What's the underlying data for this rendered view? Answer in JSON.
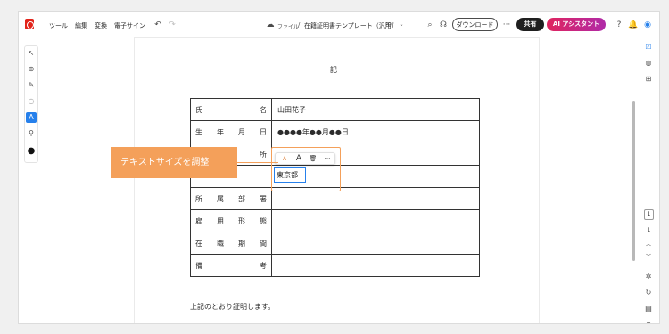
{
  "menu": {
    "tools": "ツール",
    "edit": "編集",
    "convert": "変換",
    "esign": "電子サイン"
  },
  "file": {
    "breadcrumb": "ファイル",
    "separator": "/",
    "name": "在籍証明書テンプレート（汎用）",
    "type": "PDF"
  },
  "buttons": {
    "download": "ダウンロード",
    "share": "共有",
    "ai_assistant": "AI アシスタント",
    "more": "···"
  },
  "document": {
    "heading": "記",
    "rows": [
      {
        "label": [
          "氏",
          "名"
        ],
        "value": "山田花子"
      },
      {
        "label": [
          "生",
          "年",
          "月",
          "日"
        ],
        "value": "●●●●年●●月●●日"
      },
      {
        "label": [
          "",
          "所"
        ],
        "value": ""
      },
      {
        "label": [
          "",
          ""
        ],
        "value": ""
      },
      {
        "label": [
          "所",
          "属",
          "部",
          "署"
        ],
        "value": ""
      },
      {
        "label": [
          "雇",
          "用",
          "形",
          "態"
        ],
        "value": ""
      },
      {
        "label": [
          "在",
          "職",
          "期",
          "間"
        ],
        "value": ""
      },
      {
        "label": [
          "備",
          "考"
        ],
        "value": ""
      }
    ],
    "footer": "上記のとおり証明します。"
  },
  "callout": {
    "text": "テキストサイズを調整"
  },
  "edit": {
    "textbox_value": "東京都",
    "toolbar": {
      "decrease": "A",
      "increase": "A",
      "delete": "🗑",
      "more": "···"
    }
  },
  "pagination": {
    "current": "1",
    "total": "1"
  },
  "colors": {
    "accent": "#2680eb",
    "callout": "#f4a05a",
    "brand": "#e2231a",
    "ai_gradient_start": "#e0245e",
    "ai_gradient_end": "#b02aa8"
  }
}
